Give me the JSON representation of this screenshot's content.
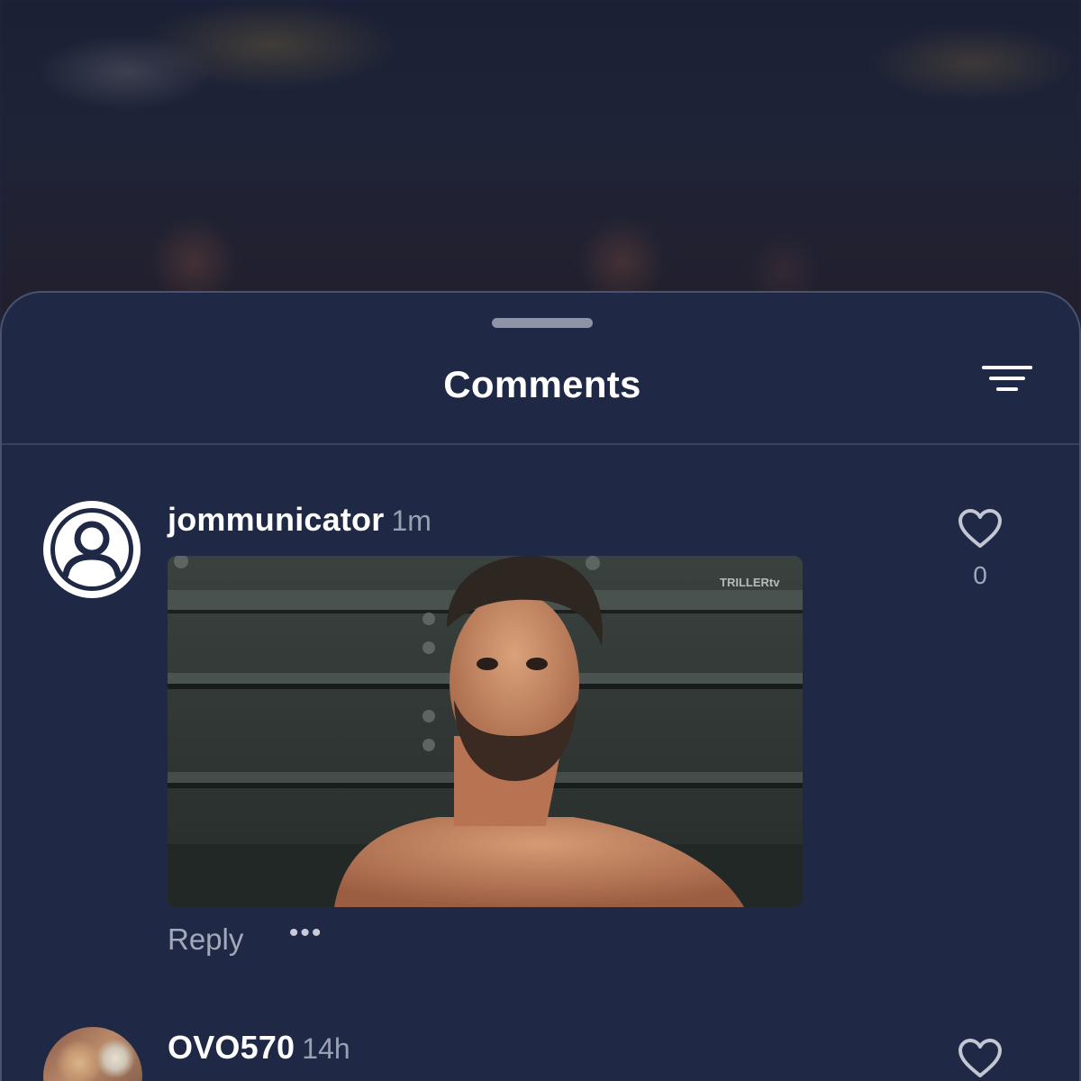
{
  "sheet": {
    "title": "Comments"
  },
  "comments": [
    {
      "author": "jommunicator",
      "time": "1m",
      "likes": "0",
      "media_watermark": "TRILLERtv",
      "reply_label": "Reply",
      "more_label": "•••"
    },
    {
      "author": "OVO570",
      "time": "14h"
    }
  ],
  "colors": {
    "sheet_bg": "#1f2844",
    "secondary_text": "#a3a8ba"
  }
}
